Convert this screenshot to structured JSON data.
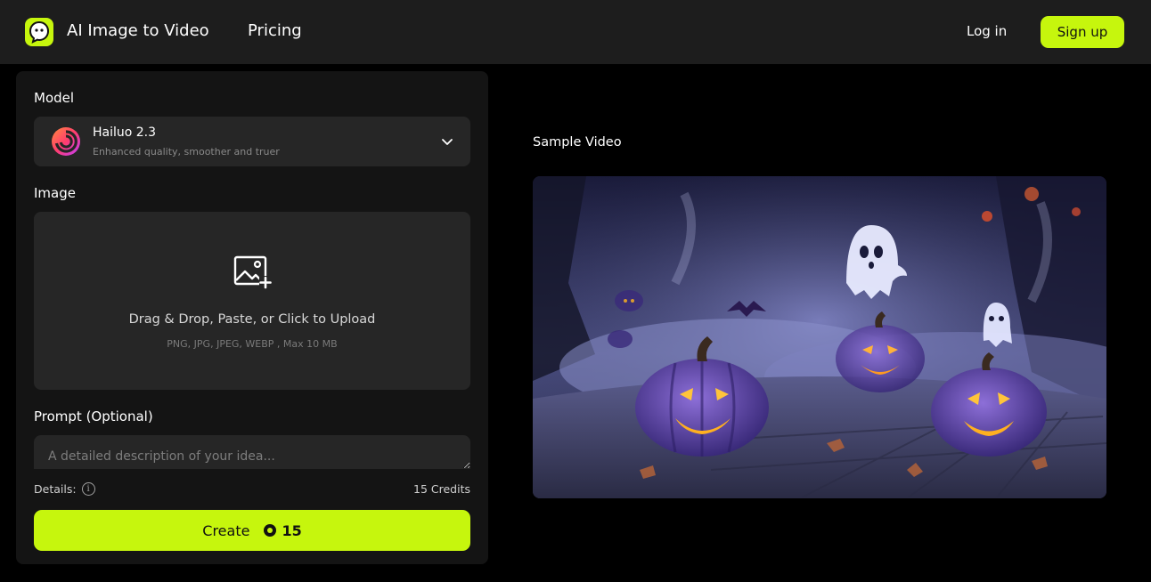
{
  "header": {
    "brand": "AI Image to Video",
    "nav_pricing": "Pricing",
    "login": "Log in",
    "signup": "Sign up"
  },
  "panel": {
    "model_label": "Model",
    "model": {
      "name": "Hailuo 2.3",
      "description": "Enhanced quality, smoother and truer"
    },
    "image_label": "Image",
    "upload": {
      "title": "Drag & Drop, Paste, or Click to Upload",
      "hint": "PNG, JPG, JPEG, WEBP , Max 10 MB"
    },
    "prompt_label": "Prompt (Optional)",
    "prompt_placeholder": "A detailed description of your idea...",
    "details_label": "Details:",
    "credits_text": "15 Credits",
    "create_label": "Create",
    "create_cost": "15"
  },
  "sample": {
    "title": "Sample Video"
  },
  "colors": {
    "accent": "#c6f60d",
    "header_bg": "#1d1d1d",
    "panel_bg": "#141414",
    "field_bg": "#262626"
  }
}
